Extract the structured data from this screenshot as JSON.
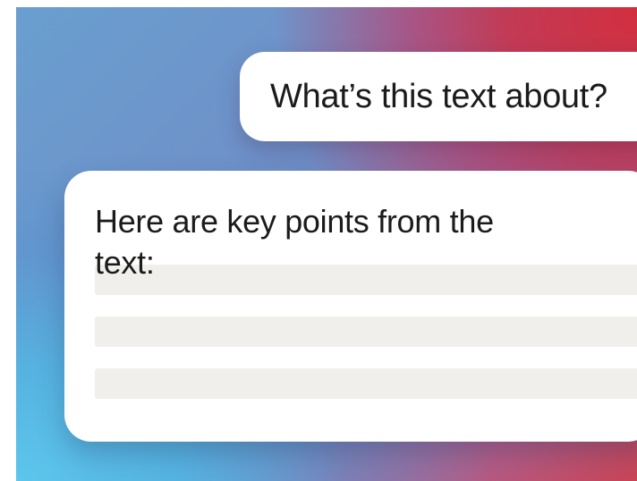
{
  "conversation": {
    "user_message": "What’s this text about?",
    "assistant_message": "Here are key points from the text:",
    "placeholder_line_count": 3
  },
  "colors": {
    "background_top_right": "#d22f3e",
    "background_bottom_left": "#5cc6ec",
    "bubble": "#ffffff",
    "placeholder": "#f0efec",
    "text": "#1b1b1b"
  }
}
